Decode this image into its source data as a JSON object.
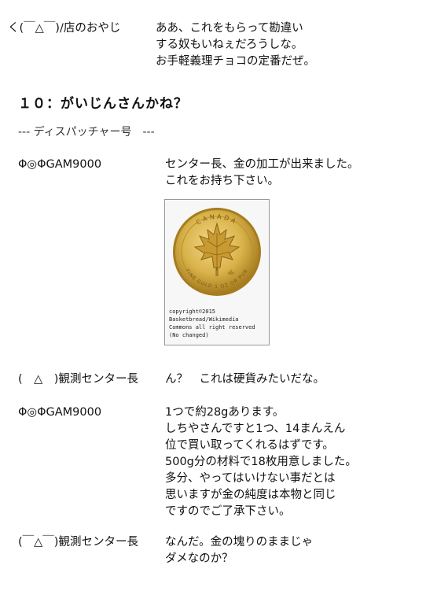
{
  "intro": {
    "speaker": "く(￣△￣)/店のおやじ",
    "lines": [
      "ああ、これをもらって勘違い",
      "する奴もいねぇだろうしな。",
      "お手軽義理チョコの定番だぜ。"
    ]
  },
  "heading": "１０：がいじんさんかね？",
  "separator": "--- ディスパッチャー号　---",
  "dialogue": [
    {
      "speaker": "Φ◎ΦGAM9000",
      "lines": [
        "センター長、金の加工が出来ました。",
        "これをお持ち下さい。"
      ]
    },
    {
      "speaker": "(　△　)観測センター長",
      "lines": [
        "ん？　これは硬貨みたいだな。"
      ]
    },
    {
      "speaker": "Φ◎ΦGAM9000",
      "lines": [
        "1つで約28gあります。",
        "しちやさんですと1つ、14まんえん",
        "位で買い取ってくれるはずです。",
        "500g分の材料で18枚用意しました。",
        "多分、やってはいけない事だとは",
        "思いますが金の純度は本物と同じ",
        "ですのでご了承下さい。"
      ]
    },
    {
      "speaker": "(￣△￣)観測センター長",
      "lines": [
        "なんだ。金の塊りのままじゃ",
        "ダメなのか？"
      ]
    }
  ],
  "coin_image": {
    "colors": {
      "gold": "#d9b24a",
      "gold_dark": "#a67c1f",
      "gold_light": "#f3d98a"
    },
    "coin_text_top": "CANADA",
    "coin_text_bottom": "FINE GOLD 1 OZ OR PUR",
    "credit": [
      "copyright©2015",
      "Basketbread/Wikimedia",
      "Commons all right reserved",
      "(No changed)"
    ]
  }
}
